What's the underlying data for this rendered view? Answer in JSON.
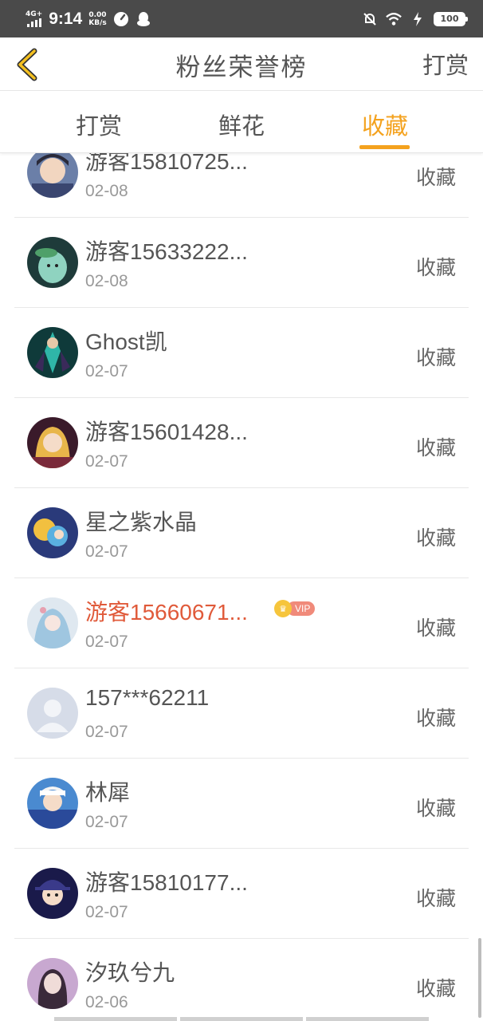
{
  "status_bar": {
    "network": "4G+",
    "time": "9:14",
    "speed_value": "0.00",
    "speed_unit": "KB/s",
    "battery": "100"
  },
  "header": {
    "title": "粉丝荣誉榜",
    "right_action": "打赏"
  },
  "tabs": [
    {
      "label": "打赏",
      "active": false
    },
    {
      "label": "鲜花",
      "active": false
    },
    {
      "label": "收藏",
      "active": true
    }
  ],
  "colors": {
    "accent": "#f4a21e",
    "vip_name": "#e05a3a",
    "status_bar": "#4a4a4a"
  },
  "fans": [
    {
      "name": "游客15810725...",
      "date": "02-08",
      "action": "收藏",
      "avatar_icon": "anime-avatar"
    },
    {
      "name": "游客15633222...",
      "date": "02-08",
      "action": "收藏",
      "avatar_icon": "green-creature-avatar"
    },
    {
      "name": "Ghost凯",
      "date": "02-07",
      "action": "收藏",
      "avatar_icon": "warrior-avatar"
    },
    {
      "name": "游客15601428...",
      "date": "02-07",
      "action": "收藏",
      "avatar_icon": "anime-girl-avatar"
    },
    {
      "name": "星之紫水晶",
      "date": "02-07",
      "action": "收藏",
      "avatar_icon": "fantasy-avatar"
    },
    {
      "name": "游客15660671...",
      "date": "02-07",
      "action": "收藏",
      "avatar_icon": "ice-anime-avatar",
      "vip": true,
      "vip_label": "VIP"
    },
    {
      "name": "157***62211",
      "date": "02-07",
      "action": "收藏",
      "avatar_icon": "default-user-avatar"
    },
    {
      "name": "林犀",
      "date": "02-07",
      "action": "收藏",
      "avatar_icon": "anime-boy-avatar"
    },
    {
      "name": "游客15810177...",
      "date": "02-07",
      "action": "收藏",
      "avatar_icon": "kid-avatar"
    },
    {
      "name": "汐玖兮九",
      "date": "02-06",
      "action": "收藏",
      "avatar_icon": "photo-avatar"
    }
  ]
}
